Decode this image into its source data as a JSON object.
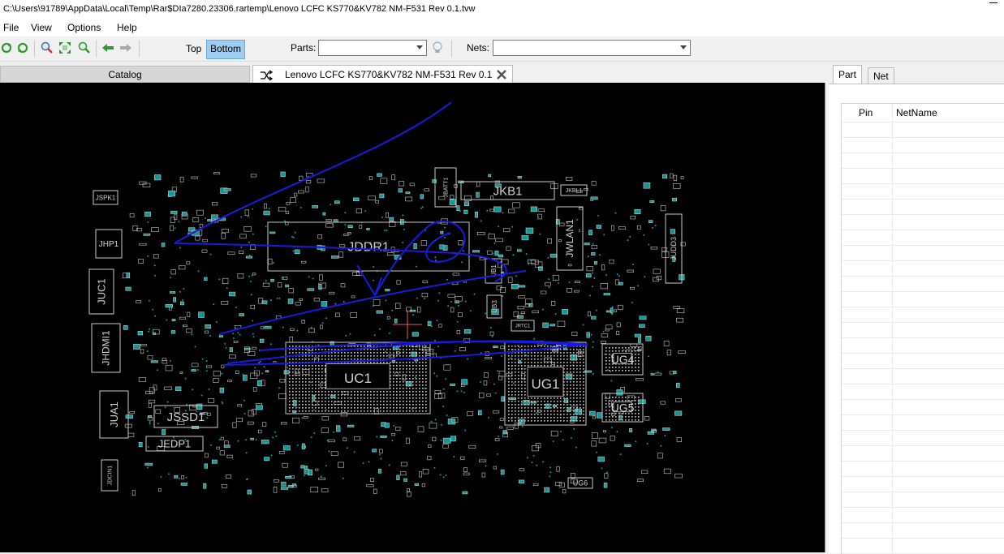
{
  "window": {
    "title": "C:\\Users\\91789\\AppData\\Local\\Temp\\Rar$DIa7280.23306.rartemp\\Lenovo LCFC KS770&KV782 NM-F531 Rev 0.1.tvw"
  },
  "menu": {
    "items": [
      "File",
      "View",
      "Options",
      "Help"
    ]
  },
  "toolbar": {
    "top_label": "Top",
    "bottom_label": "Bottom",
    "active_side": "Bottom",
    "parts_label": "Parts:",
    "parts_value": "",
    "nets_label": "Nets:",
    "nets_value": "",
    "icons": [
      "refresh-icon",
      "reload-icon",
      "zoom-icon",
      "fit-icon",
      "zoom-area-icon",
      "back-arrow-icon",
      "forward-arrow-icon",
      "lightbulb-icon"
    ]
  },
  "tabs": {
    "catalog": "Catalog",
    "document": "Lenovo LCFC KS770&KV782 NM-F531 Rev 0.1"
  },
  "board": {
    "labels": [
      "JSPK1",
      "JHP1",
      "JUC1",
      "JHDMI1",
      "JUA1",
      "JSSD1",
      "JEDP1",
      "JDCIN1",
      "JBATT1",
      "JKB1",
      "JKBL1",
      "JWLAN1",
      "JDDR1",
      "JUDD3",
      "UB1",
      "UB3",
      "JRTC1",
      "UC1",
      "UG1",
      "UG4",
      "UG5",
      "UG6"
    ],
    "colors": {
      "background": "#000000",
      "silkscreen": "#c8c8c8",
      "annotation": "#1a1adc",
      "pads": "#0f9a9a",
      "cursor": "#e05a5a"
    }
  },
  "side_panel": {
    "tabs": [
      "Part",
      "Net"
    ],
    "active_tab": "Part",
    "columns": [
      "Pin",
      "NetName"
    ],
    "rows": []
  }
}
